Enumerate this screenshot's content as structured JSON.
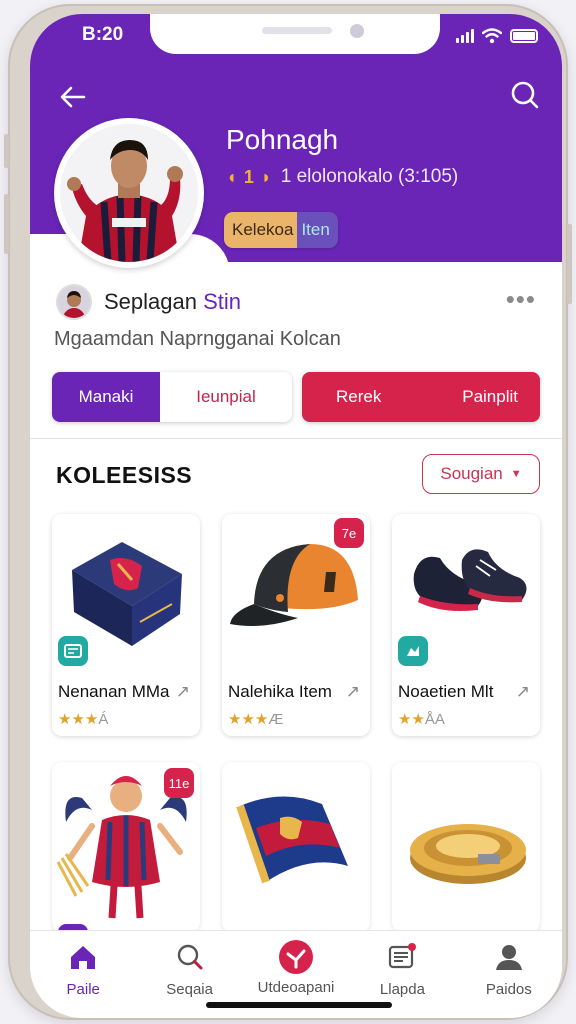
{
  "status_bar": {
    "time": "B:20"
  },
  "header": {
    "profile_name": "Pohnagh",
    "medals": "◖ 1 ◗",
    "rating_text": "1 elolonokalo (3:105)",
    "badge_left": "Kelekoa",
    "badge_right": "Iten"
  },
  "user": {
    "name": "Seplagan",
    "name_accent": "Stin",
    "subtitle": "Mgaamdan Naprngganai Kolcan"
  },
  "tabs": {
    "active": "Manaki",
    "inactive": "Ieunpial",
    "red_left": "Rerek",
    "red_right": "Painplit"
  },
  "collection": {
    "title": "KOLEESISS",
    "sort_label": "Sougian"
  },
  "cards": [
    {
      "name": "Nenanan MMa",
      "stars": "★★★",
      "stars_muted": "Á",
      "share": "↗"
    },
    {
      "name": "Nalehika Item",
      "stars": "★★★",
      "stars_muted": "Æ",
      "share": "↗",
      "tag": "7e"
    },
    {
      "name": "Noaetien Mlt",
      "stars": "★★",
      "stars_muted": "ÅA",
      "share": "↗"
    }
  ],
  "cards_row2": [
    {
      "tag": "11e"
    }
  ],
  "bottom_nav": [
    {
      "label": "Paile",
      "icon": "home-icon"
    },
    {
      "label": "Seqaia",
      "icon": "search-icon"
    },
    {
      "label": "Utdeoapani",
      "icon": "star-badge-icon"
    },
    {
      "label": "Llapda",
      "icon": "message-icon"
    },
    {
      "label": "Paidos",
      "icon": "profile-icon"
    }
  ],
  "colors": {
    "brand_purple": "#6a25b6",
    "accent_red": "#d6234c",
    "gold": "#e0a32b"
  }
}
